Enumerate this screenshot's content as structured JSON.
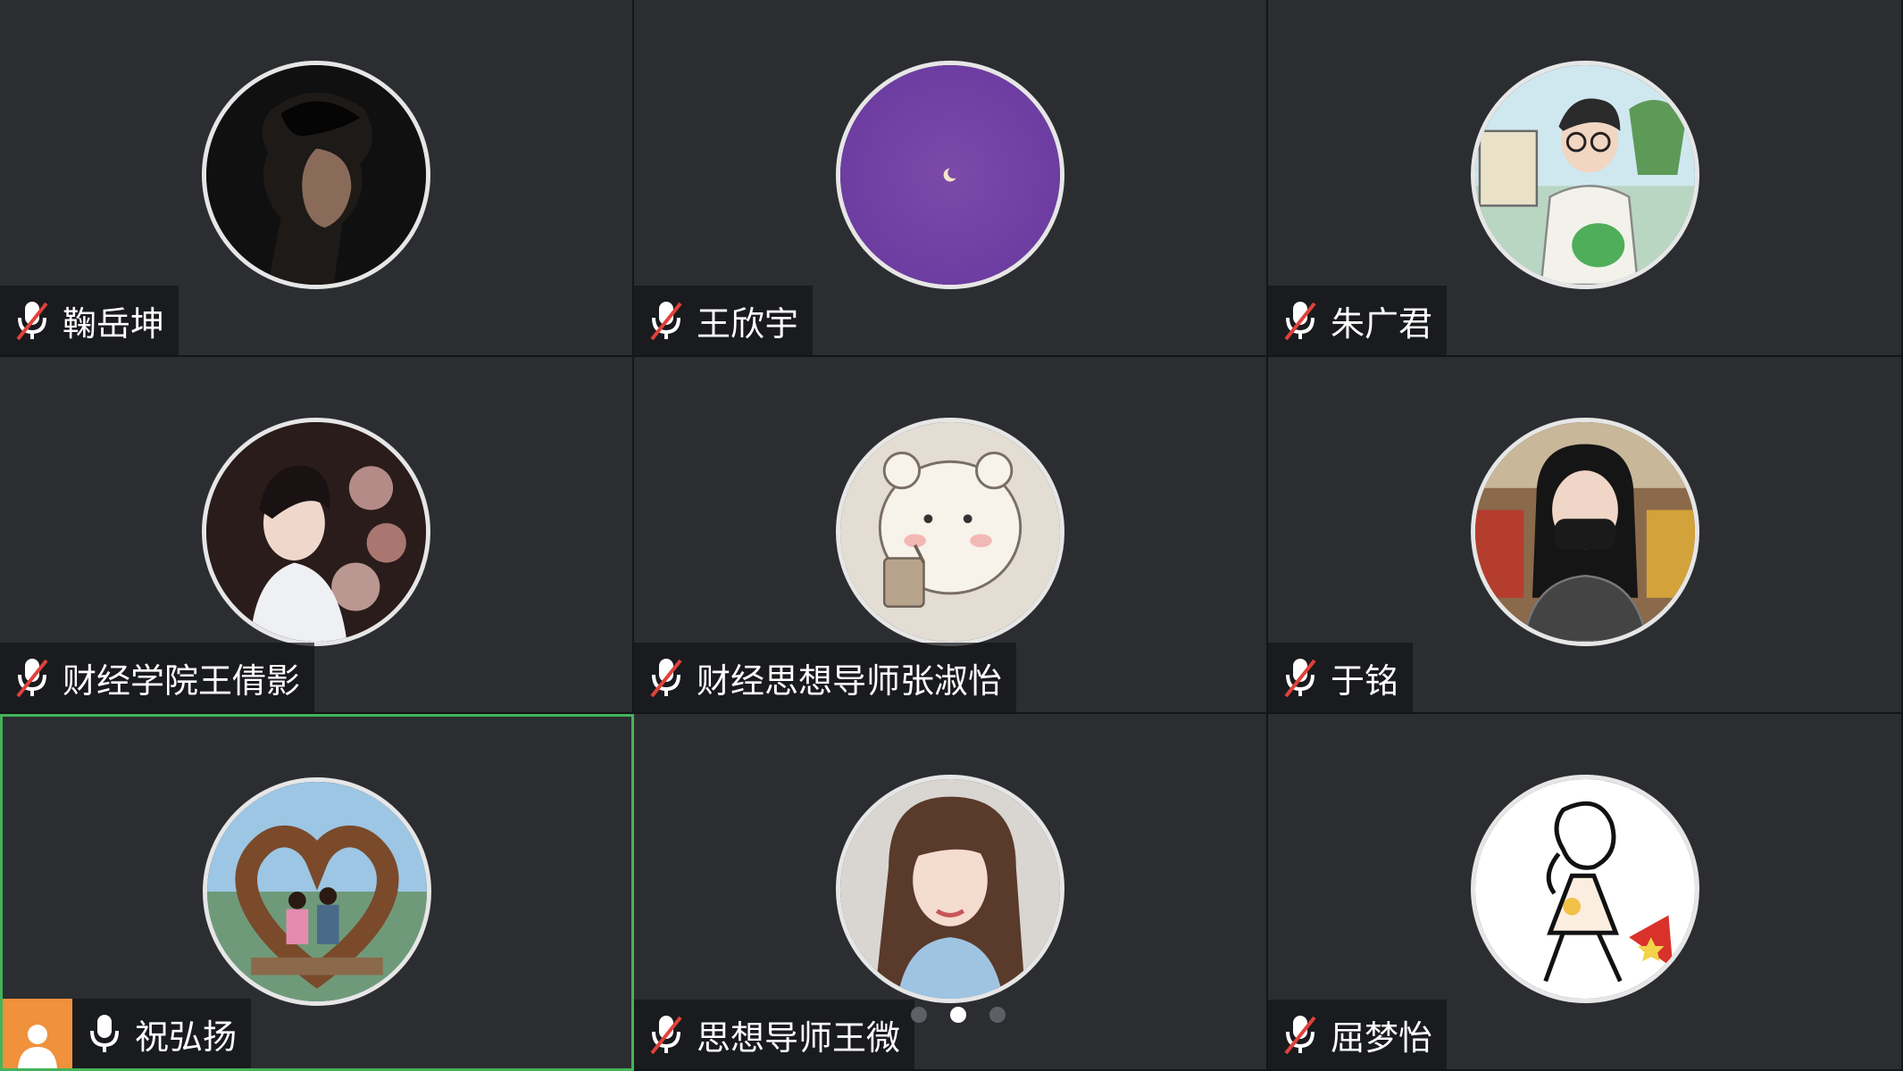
{
  "participants": [
    {
      "name": "鞠岳坤",
      "mic": "muted"
    },
    {
      "name": "王欣宇",
      "mic": "muted"
    },
    {
      "name": "朱广君",
      "mic": "muted"
    },
    {
      "name": "财经学院王倩影",
      "mic": "muted"
    },
    {
      "name": "财经思想导师张淑怡",
      "mic": "muted"
    },
    {
      "name": "于铭",
      "mic": "muted"
    },
    {
      "name": "祝弘扬",
      "mic": "on",
      "active_speaker": true
    },
    {
      "name": "思想导师王微",
      "mic": "muted"
    },
    {
      "name": "屈梦怡",
      "mic": "muted"
    }
  ],
  "pagination": {
    "pages": 3,
    "current": 2
  },
  "colors": {
    "tile_bg": "#2c2d31",
    "active_border": "#43b35a",
    "host_badge": "#f0913c",
    "muted_slash": "#e0413b"
  }
}
